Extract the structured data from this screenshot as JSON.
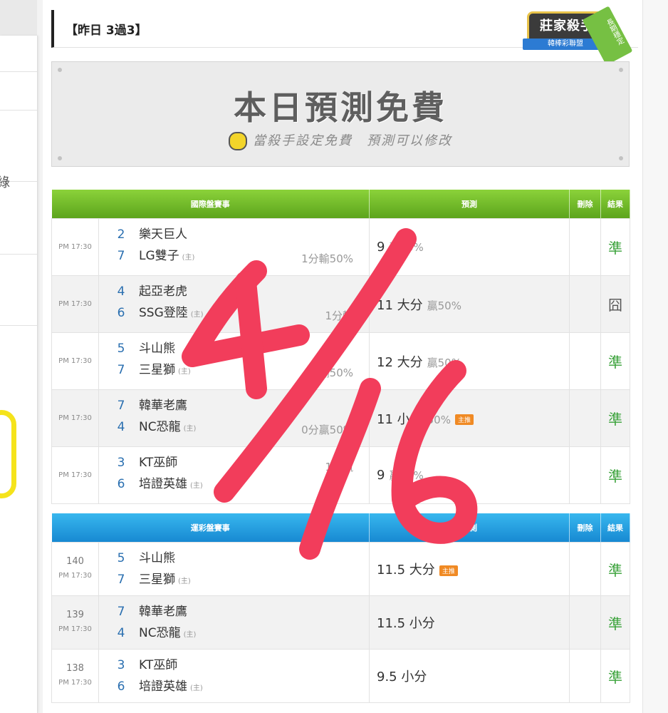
{
  "sidebar": {
    "fragment_text": "綠"
  },
  "yesterday": {
    "label": "【昨日 3過3】"
  },
  "badge": {
    "main": "莊家殺手",
    "ribbon": "韓棒彩聯盟",
    "sash": "長期穩定"
  },
  "banner": {
    "title": "本日預測免費",
    "subtitle": "當殺手設定免費　預測可以修改"
  },
  "table_intl": {
    "headers": {
      "match": "國際盤賽事",
      "prediction": "預測",
      "delete": "刪除",
      "result": "結果"
    },
    "rows": [
      {
        "time": "PM 17:30",
        "away_score": "2",
        "away": "樂天巨人",
        "home_score": "7",
        "home": "LG雙子",
        "home_tag": "(主)",
        "handicap": "1分輸50%",
        "pred": "9",
        "pred_win": "贏50%",
        "tag": "",
        "result": "準"
      },
      {
        "time": "PM 17:30",
        "away_score": "4",
        "away": "起亞老虎",
        "home_score": "6",
        "home": "SSG登陸",
        "home_tag": "(主)",
        "handicap": "1分輸",
        "pred": "11 大分",
        "pred_win": "贏50%",
        "tag": "",
        "result": "囧"
      },
      {
        "time": "PM 17:30",
        "away_score": "5",
        "away": "斗山熊",
        "home_score": "7",
        "home": "三星獅",
        "home_tag": "(主)",
        "handicap": "輸50%",
        "pred": "12 大分",
        "pred_win": "贏50%",
        "tag": "",
        "result": "準"
      },
      {
        "time": "PM 17:30",
        "away_score": "7",
        "away": "韓華老鷹",
        "home_score": "4",
        "home": "NC恐龍",
        "home_tag": "(主)",
        "handicap": "0分贏50%",
        "pred": "11 小分",
        "pred_win": "50%",
        "tag": "主推",
        "result": "準"
      },
      {
        "time": "PM 17:30",
        "away_score": "3",
        "away": "KT巫師",
        "home_score": "6",
        "home": "培證英雄",
        "home_tag": "(主)",
        "handicap": "1分贏",
        "pred": "9",
        "pred_win": "贏50%",
        "tag": "",
        "result": "準"
      }
    ]
  },
  "table_sport": {
    "headers": {
      "match": "運彩盤賽事",
      "prediction": "預測",
      "delete": "刪除",
      "result": "結果"
    },
    "rows": [
      {
        "num": "140",
        "time": "PM 17:30",
        "away_score": "5",
        "away": "斗山熊",
        "home_score": "7",
        "home": "三星獅",
        "home_tag": "(主)",
        "pred": "11.5 大分",
        "tag": "主推",
        "result": "準"
      },
      {
        "num": "139",
        "time": "PM 17:30",
        "away_score": "7",
        "away": "韓華老鷹",
        "home_score": "4",
        "home": "NC恐龍",
        "home_tag": "(主)",
        "pred": "11.5 小分",
        "tag": "",
        "result": "準"
      },
      {
        "num": "138",
        "time": "PM 17:30",
        "away_score": "3",
        "away": "KT巫師",
        "home_score": "6",
        "home": "培證英雄",
        "home_tag": "(主)",
        "pred": "9.5 小分",
        "tag": "",
        "result": "準"
      }
    ]
  },
  "overlay": {
    "date": "4/16",
    "color": "#f23d5b"
  },
  "colors": {
    "green_header": "#5ca41c",
    "blue_header": "#1789d2",
    "hit": "#3aa23a"
  }
}
